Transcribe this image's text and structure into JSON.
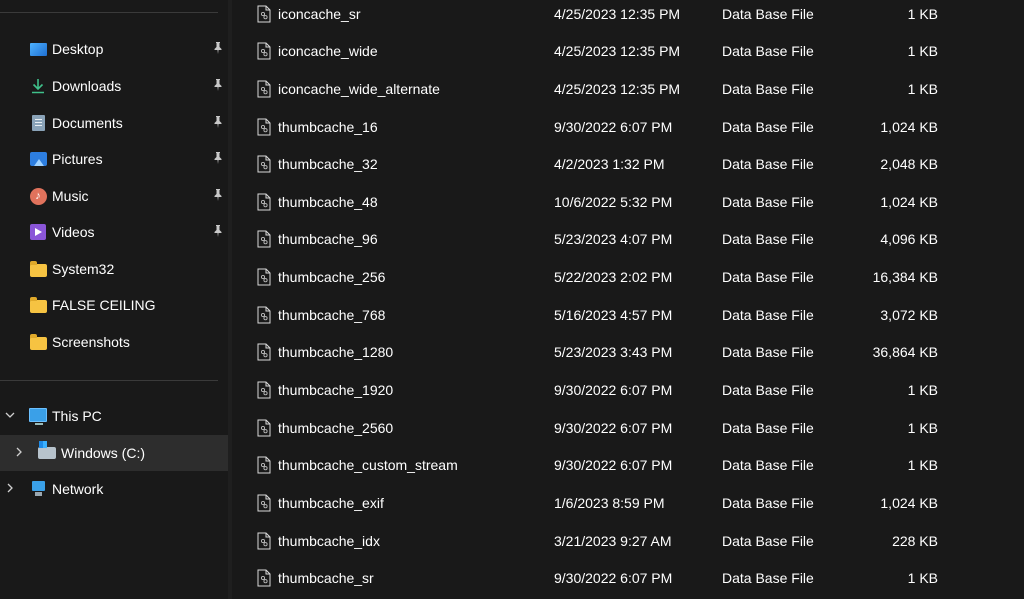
{
  "nav": {
    "quick_access": [
      {
        "label": "Desktop",
        "icon": "desktop-icon",
        "pinned": true
      },
      {
        "label": "Downloads",
        "icon": "download-arrow-icon",
        "pinned": true
      },
      {
        "label": "Documents",
        "icon": "documents-icon",
        "pinned": true
      },
      {
        "label": "Pictures",
        "icon": "pictures-icon",
        "pinned": true
      },
      {
        "label": "Music",
        "icon": "music-icon",
        "pinned": true
      },
      {
        "label": "Videos",
        "icon": "videos-icon",
        "pinned": true
      },
      {
        "label": "System32",
        "icon": "folder-icon",
        "pinned": false
      },
      {
        "label": "FALSE CEILING",
        "icon": "folder-icon",
        "pinned": false
      },
      {
        "label": "Screenshots",
        "icon": "folder-icon",
        "pinned": false
      }
    ],
    "this_pc": {
      "label": "This PC",
      "expanded": true
    },
    "drive": {
      "label": "Windows (C:)",
      "selected": true
    },
    "network": {
      "label": "Network"
    }
  },
  "files": [
    {
      "name": "iconcache_sr",
      "date": "4/25/2023 12:35 PM",
      "type": "Data Base File",
      "size": "1 KB"
    },
    {
      "name": "iconcache_wide",
      "date": "4/25/2023 12:35 PM",
      "type": "Data Base File",
      "size": "1 KB"
    },
    {
      "name": "iconcache_wide_alternate",
      "date": "4/25/2023 12:35 PM",
      "type": "Data Base File",
      "size": "1 KB"
    },
    {
      "name": "thumbcache_16",
      "date": "9/30/2022 6:07 PM",
      "type": "Data Base File",
      "size": "1,024 KB"
    },
    {
      "name": "thumbcache_32",
      "date": "4/2/2023 1:32 PM",
      "type": "Data Base File",
      "size": "2,048 KB"
    },
    {
      "name": "thumbcache_48",
      "date": "10/6/2022 5:32 PM",
      "type": "Data Base File",
      "size": "1,024 KB"
    },
    {
      "name": "thumbcache_96",
      "date": "5/23/2023 4:07 PM",
      "type": "Data Base File",
      "size": "4,096 KB"
    },
    {
      "name": "thumbcache_256",
      "date": "5/22/2023 2:02 PM",
      "type": "Data Base File",
      "size": "16,384 KB"
    },
    {
      "name": "thumbcache_768",
      "date": "5/16/2023 4:57 PM",
      "type": "Data Base File",
      "size": "3,072 KB"
    },
    {
      "name": "thumbcache_1280",
      "date": "5/23/2023 3:43 PM",
      "type": "Data Base File",
      "size": "36,864 KB"
    },
    {
      "name": "thumbcache_1920",
      "date": "9/30/2022 6:07 PM",
      "type": "Data Base File",
      "size": "1 KB"
    },
    {
      "name": "thumbcache_2560",
      "date": "9/30/2022 6:07 PM",
      "type": "Data Base File",
      "size": "1 KB"
    },
    {
      "name": "thumbcache_custom_stream",
      "date": "9/30/2022 6:07 PM",
      "type": "Data Base File",
      "size": "1 KB"
    },
    {
      "name": "thumbcache_exif",
      "date": "1/6/2023 8:59 PM",
      "type": "Data Base File",
      "size": "1,024 KB"
    },
    {
      "name": "thumbcache_idx",
      "date": "3/21/2023 9:27 AM",
      "type": "Data Base File",
      "size": "228 KB"
    },
    {
      "name": "thumbcache_sr",
      "date": "9/30/2022 6:07 PM",
      "type": "Data Base File",
      "size": "1 KB"
    }
  ],
  "colors": {
    "background": "#191919",
    "selected_row": "#2d2d2d",
    "text": "#ffffff"
  }
}
